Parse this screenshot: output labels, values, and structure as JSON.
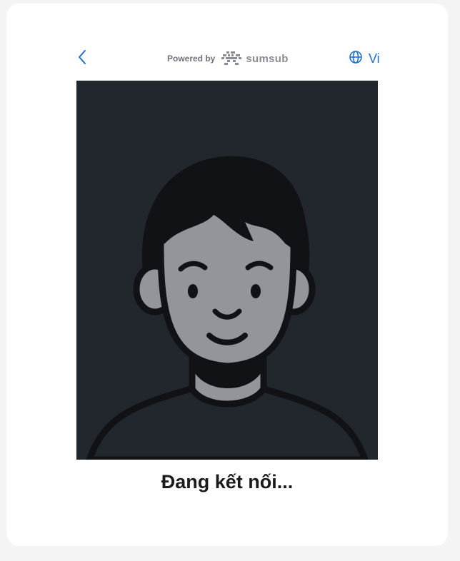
{
  "header": {
    "back_icon": "chevron-left-icon",
    "powered_by_label": "Powered by",
    "brand_name": "sumsub",
    "language_icon": "globe-icon",
    "language_label": "Vi"
  },
  "camera": {
    "placeholder": "avatar-silhouette"
  },
  "status": {
    "text": "Đang kết nối..."
  },
  "colors": {
    "accent": "#1e6fd0",
    "camera_bg": "#22262d",
    "avatar_skin": "#93959a",
    "avatar_hair": "#101215",
    "page_bg": "#f4f4f4",
    "card_bg": "#ffffff"
  }
}
